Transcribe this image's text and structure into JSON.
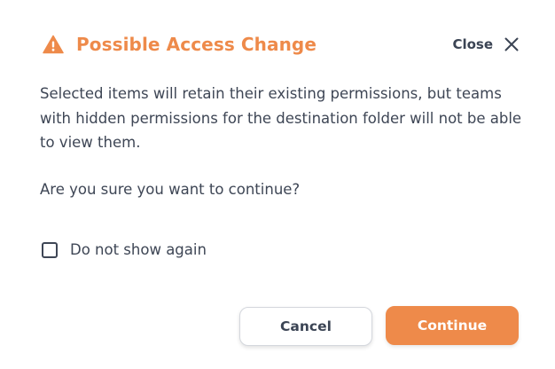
{
  "dialog": {
    "title": "Possible Access Change",
    "title_icon": "warning-triangle-icon",
    "close_label": "Close",
    "close_icon": "close-x-icon",
    "message": "Selected items will retain their existing permissions, but teams with hidden permissions for the destination folder will not be able to view them.",
    "question": "Are you sure you want to continue?",
    "checkbox": {
      "label": "Do not show again",
      "checked": false
    },
    "buttons": {
      "cancel_label": "Cancel",
      "continue_label": "Continue"
    }
  },
  "colors": {
    "accent": "#ee8a4a",
    "text": "#3e4655",
    "background": "#ffffff",
    "border": "#d4d7dd"
  }
}
